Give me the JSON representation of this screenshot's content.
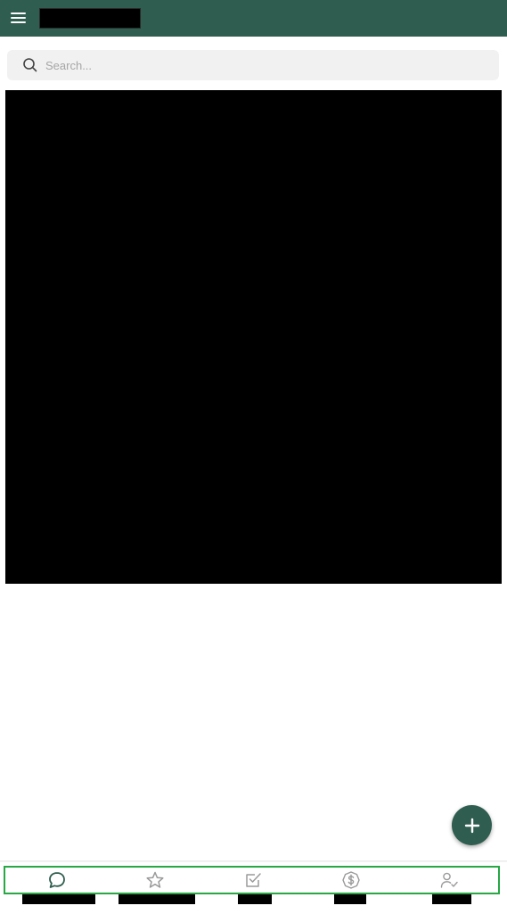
{
  "app_bar": {
    "menu_icon": "hamburger-menu-icon",
    "title_redacted": true
  },
  "search": {
    "placeholder": "Search...",
    "value": "",
    "icon": "search-icon"
  },
  "content": {
    "redacted": true
  },
  "fab": {
    "icon": "plus-icon"
  },
  "bottom_nav": {
    "active_index": 0,
    "items": [
      {
        "icon": "chat-bubble-icon",
        "label_redacted": true
      },
      {
        "icon": "star-icon",
        "label_redacted": true
      },
      {
        "icon": "checkbox-icon",
        "label_redacted": true
      },
      {
        "icon": "dollar-coin-icon",
        "label_redacted": true
      },
      {
        "icon": "user-check-icon",
        "label_redacted": true
      }
    ]
  },
  "colors": {
    "primary": "#2f5d4f",
    "search_bg": "#f1f1f1",
    "nav_highlight": "#28a745",
    "icon_active": "#2f5d4f",
    "icon_inactive": "#9a9a9a"
  }
}
